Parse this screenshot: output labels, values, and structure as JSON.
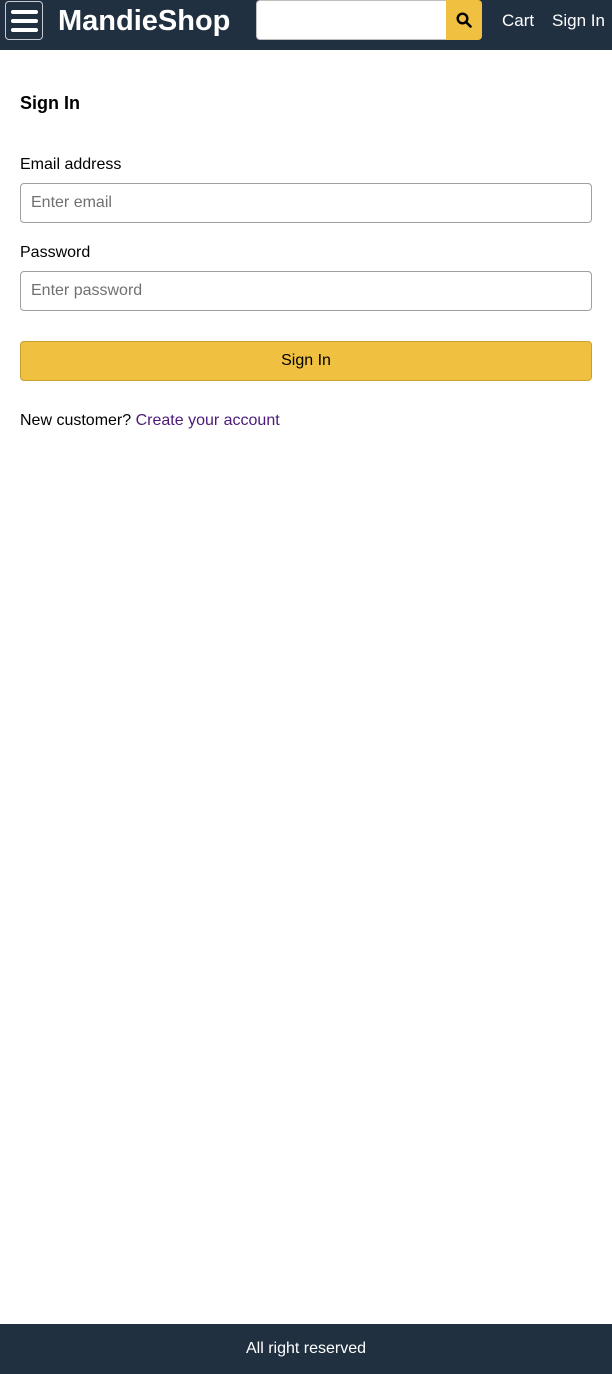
{
  "header": {
    "brand": "MandieShop",
    "search": {
      "value": "",
      "placeholder": ""
    },
    "nav": {
      "cart": "Cart",
      "sign_in": "Sign In"
    },
    "icons": {
      "menu": "hamburger-menu-icon",
      "search": "search-icon"
    },
    "colors": {
      "background": "#203040",
      "accent": "#f0c040"
    }
  },
  "main": {
    "title": "Sign In",
    "email": {
      "label": "Email address",
      "placeholder": "Enter email",
      "value": ""
    },
    "password": {
      "label": "Password",
      "placeholder": "Enter password",
      "value": ""
    },
    "submit_label": "Sign In",
    "new_customer_text": "New customer?",
    "create_account_link": "Create your account",
    "colors": {
      "button": "#f0c040",
      "link": "#4b1a7a"
    }
  },
  "footer": {
    "text": "All right reserved"
  }
}
